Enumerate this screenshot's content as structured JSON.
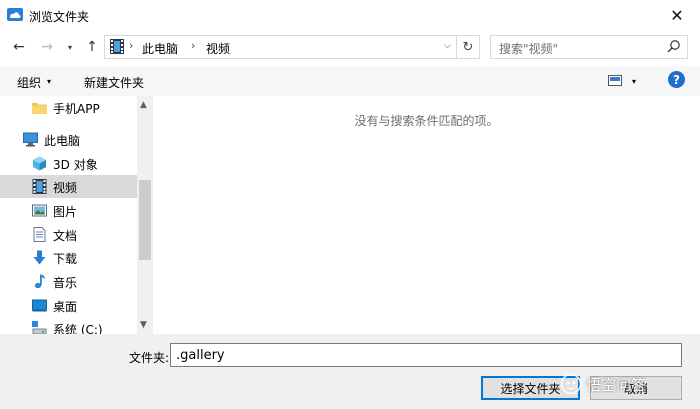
{
  "window": {
    "title": "浏览文件夹",
    "close_glyph": "✕"
  },
  "nav": {
    "back_glyph": "←",
    "forward_glyph": "→",
    "recent_glyph": "▾",
    "up_glyph": "↑",
    "breadcrumb": [
      "此电脑",
      "视频"
    ],
    "crumb_sep": "›",
    "address_dropdown_glyph": "⌵",
    "refresh_glyph": "↻",
    "search_placeholder": "搜索\"视频\""
  },
  "toolbar": {
    "organize": "组织",
    "caret": "▾",
    "new_folder": "新建文件夹",
    "help": "?"
  },
  "sidebar": {
    "items": [
      {
        "label": "手机APP",
        "icon": "folder-icon"
      },
      {
        "label": "此电脑",
        "icon": "computer-icon"
      },
      {
        "label": "3D 对象",
        "icon": "3d-objects-icon"
      },
      {
        "label": "视频",
        "icon": "videos-icon",
        "selected": true
      },
      {
        "label": "图片",
        "icon": "pictures-icon"
      },
      {
        "label": "文档",
        "icon": "documents-icon"
      },
      {
        "label": "下载",
        "icon": "downloads-icon"
      },
      {
        "label": "音乐",
        "icon": "music-icon"
      },
      {
        "label": "桌面",
        "icon": "desktop-icon"
      },
      {
        "label": "系统 (C:)",
        "icon": "drive-icon"
      }
    ],
    "scroll_up_glyph": "▲",
    "scroll_down_glyph": "▼"
  },
  "content": {
    "empty_message": "没有与搜索条件匹配的项。"
  },
  "footer": {
    "folder_label": "文件夹:",
    "folder_value": ".gallery",
    "select_button": "选择文件夹",
    "cancel_button": "取消"
  },
  "watermark": {
    "text": "悟空问答"
  },
  "colors": {
    "accent": "#0078d7",
    "selected_bg": "#d9d9d9",
    "help_blue": "#1f6fd1"
  }
}
